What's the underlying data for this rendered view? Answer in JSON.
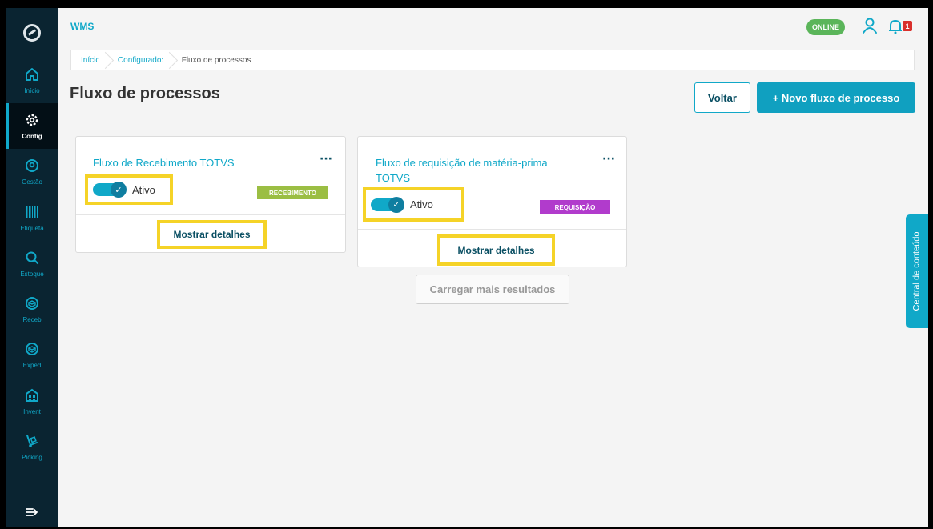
{
  "app": {
    "title": "WMS",
    "status": "ONLINE",
    "notification_count": "1"
  },
  "sidebar": {
    "items": [
      {
        "label": "Início",
        "icon": "home-icon"
      },
      {
        "label": "Config",
        "icon": "gear-icon"
      },
      {
        "label": "Gestão",
        "icon": "location-pin-icon"
      },
      {
        "label": "Etiqueta",
        "icon": "barcode-icon"
      },
      {
        "label": "Estoque",
        "icon": "search-icon"
      },
      {
        "label": "Receb",
        "icon": "box-icon"
      },
      {
        "label": "Exped",
        "icon": "box-icon"
      },
      {
        "label": "Invent",
        "icon": "inventory-icon"
      },
      {
        "label": "Picking",
        "icon": "hand-truck-icon"
      }
    ],
    "active": "Config"
  },
  "breadcrumb": {
    "items": [
      "Início",
      "Configurador",
      "Fluxo de processos"
    ]
  },
  "page": {
    "title": "Fluxo de processos"
  },
  "actions": {
    "back_label": "Voltar",
    "new_label": "+ Novo fluxo de processo"
  },
  "cards": [
    {
      "title": "Fluxo de Recebimento TOTVS",
      "toggle_label": "Ativo",
      "tag": "RECEBIMENTO",
      "tag_color": "#9bbe43",
      "details_label": "Mostrar detalhes"
    },
    {
      "title": "Fluxo de requisição de matéria-prima TOTVS",
      "toggle_label": "Ativo",
      "tag": "REQUISIÇÃO",
      "tag_color": "#b13bcc",
      "details_label": "Mostrar detalhes"
    }
  ],
  "load_more_label": "Carregar mais resultados",
  "content_center_label": "Central de conteúdo",
  "colors": {
    "accent": "#10a8c8",
    "sidebar": "#0a2431",
    "highlight": "#f5d327",
    "online": "#5bb55a"
  }
}
